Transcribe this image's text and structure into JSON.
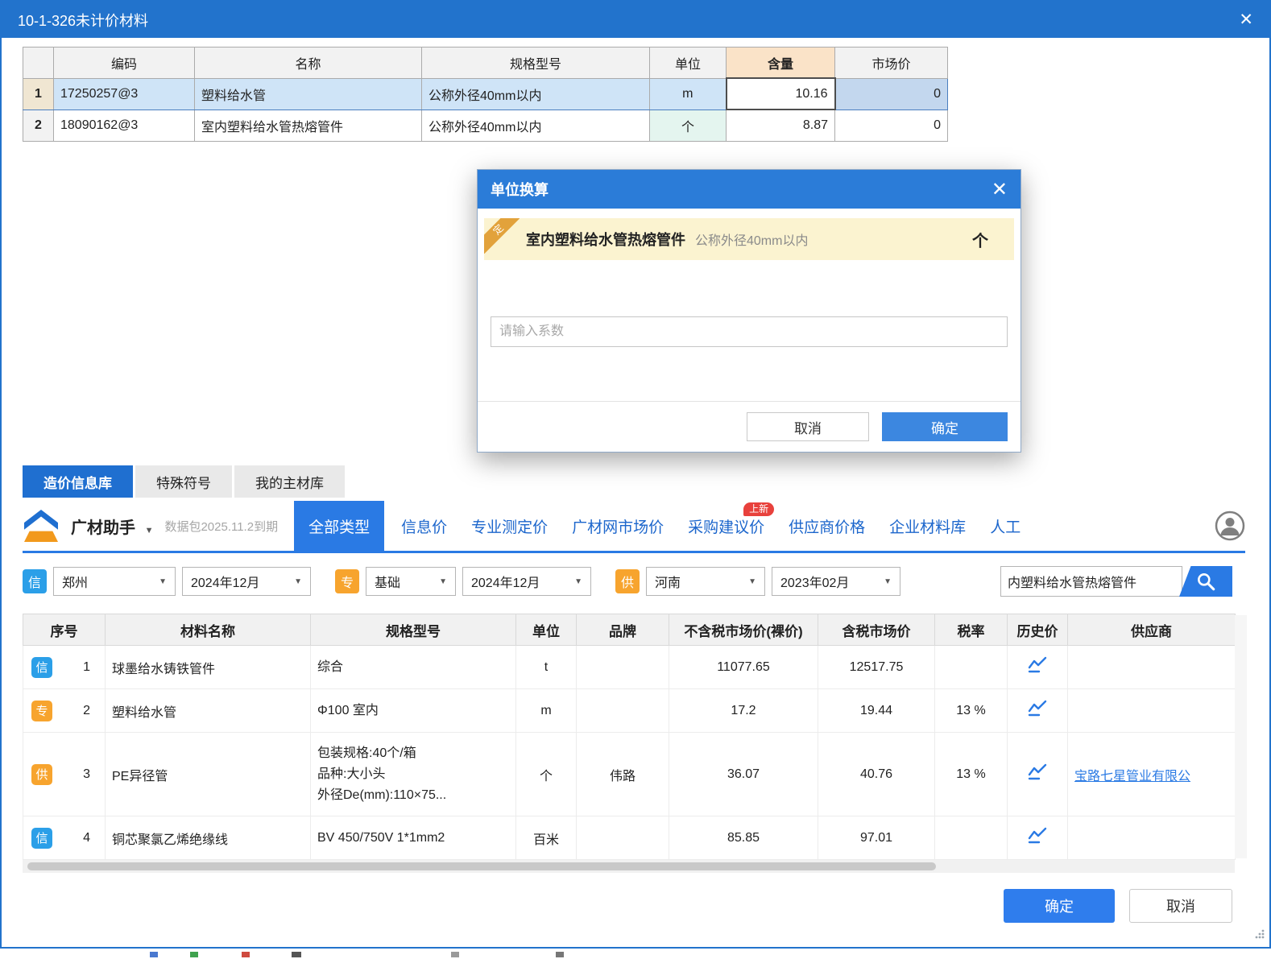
{
  "window": {
    "title": "10-1-326未计价材料"
  },
  "icons": {
    "close": "✕",
    "caret": "▼"
  },
  "top_table": {
    "headers": [
      "",
      "编码",
      "名称",
      "规格型号",
      "单位",
      "含量",
      "市场价"
    ],
    "rows": [
      {
        "num": "1",
        "code": "17250257@3",
        "name": "塑料给水管",
        "spec": "公称外径40mm以内",
        "unit": "m",
        "content": "10.16",
        "market_price": "0"
      },
      {
        "num": "2",
        "code": "18090162@3",
        "name": "室内塑料给水管热熔管件",
        "spec": "公称外径40mm以内",
        "unit": "个",
        "content": "8.87",
        "market_price": "0"
      }
    ]
  },
  "modal": {
    "title": "单位换算",
    "ribbon": "定",
    "item_name": "室内塑料给水管热熔管件",
    "item_spec": "公称外径40mm以内",
    "item_unit": "个",
    "input_placeholder": "请输入系数",
    "cancel_label": "取消",
    "ok_label": "确定"
  },
  "tabs": [
    {
      "label": "造价信息库"
    },
    {
      "label": "特殊符号"
    },
    {
      "label": "我的主材库"
    }
  ],
  "toolbar": {
    "brand": "广材助手",
    "package": "数据包2025.11.2到期",
    "nav": [
      {
        "label": "全部类型"
      },
      {
        "label": "信息价"
      },
      {
        "label": "专业测定价"
      },
      {
        "label": "广材网市场价"
      },
      {
        "label": "采购建议价",
        "badge": "上新"
      },
      {
        "label": "供应商价格"
      },
      {
        "label": "企业材料库"
      },
      {
        "label": "人工"
      }
    ]
  },
  "filters": {
    "groups": [
      {
        "badge": "信",
        "region": "郑州",
        "period": "2024年12月"
      },
      {
        "badge": "专",
        "region": "基础",
        "period": "2024年12月"
      },
      {
        "badge": "供",
        "region": "河南",
        "period": "2023年02月"
      }
    ],
    "search_value": "内塑料给水管热熔管件"
  },
  "result_table": {
    "headers": [
      "序号",
      "材料名称",
      "规格型号",
      "单位",
      "品牌",
      "不含税市场价(裸价)",
      "含税市场价",
      "税率",
      "历史价",
      "供应商"
    ],
    "rows": [
      {
        "badge": "信",
        "num": "1",
        "name": "球墨给水铸铁管件",
        "spec_lines": [
          "综合",
          "",
          ""
        ],
        "unit": "t",
        "brand": "",
        "price_ex": "11077.65",
        "price_in": "12517.75",
        "tax": "",
        "supplier": ""
      },
      {
        "badge": "专",
        "num": "2",
        "name": "塑料给水管",
        "spec_lines": [
          "Φ100 室内",
          "",
          ""
        ],
        "unit": "m",
        "brand": "",
        "price_ex": "17.2",
        "price_in": "19.44",
        "tax": "13 %",
        "supplier": ""
      },
      {
        "badge": "供",
        "num": "3",
        "name": "PE异径管",
        "spec_lines": [
          "包装规格:40个/箱",
          "品种:大小头",
          "外径De(mm):110×75..."
        ],
        "unit": "个",
        "brand": "伟路",
        "price_ex": "36.07",
        "price_in": "40.76",
        "tax": "13 %",
        "supplier": "宝路七星管业有限公"
      },
      {
        "badge": "信",
        "num": "4",
        "name": "铜芯聚氯乙烯绝缘线",
        "spec_lines": [
          "BV 450/750V 1*1mm2",
          "",
          ""
        ],
        "unit": "百米",
        "brand": "",
        "price_ex": "85.85",
        "price_in": "97.01",
        "tax": "",
        "supplier": ""
      }
    ]
  },
  "footer": {
    "ok_label": "确定",
    "cancel_label": "取消"
  },
  "colors": {
    "accent": "#2a7ae4",
    "titlebar": "#2273cc",
    "modal_header": "#2b7cd8",
    "info_badge": "#2b9fe8",
    "pro_badge": "#f7a42e",
    "selection_row": "#cfe4f7",
    "highlight_row": "#fbf3d0",
    "new_badge": "#e8413c"
  }
}
